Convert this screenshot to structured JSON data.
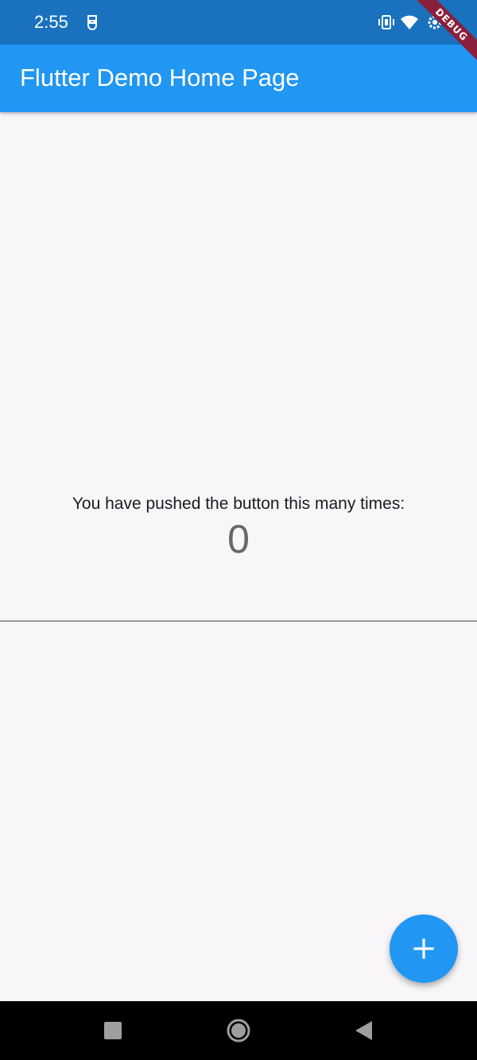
{
  "status_bar": {
    "time": "2:55",
    "icons": [
      "debug-app-icon",
      "vibrate-icon",
      "wifi-icon",
      "settings-gear-icon"
    ]
  },
  "app_bar": {
    "title": "Flutter Demo Home Page",
    "color": "#2196f3"
  },
  "debug_banner": {
    "label": "DEBUG"
  },
  "main": {
    "counter_label": "You have pushed the button this many times:",
    "counter_value": "0"
  },
  "fab": {
    "icon": "add-icon",
    "color": "#2196f3"
  },
  "nav_bar": {
    "buttons": [
      "recents-square-icon",
      "home-circle-icon",
      "back-triangle-icon"
    ]
  }
}
